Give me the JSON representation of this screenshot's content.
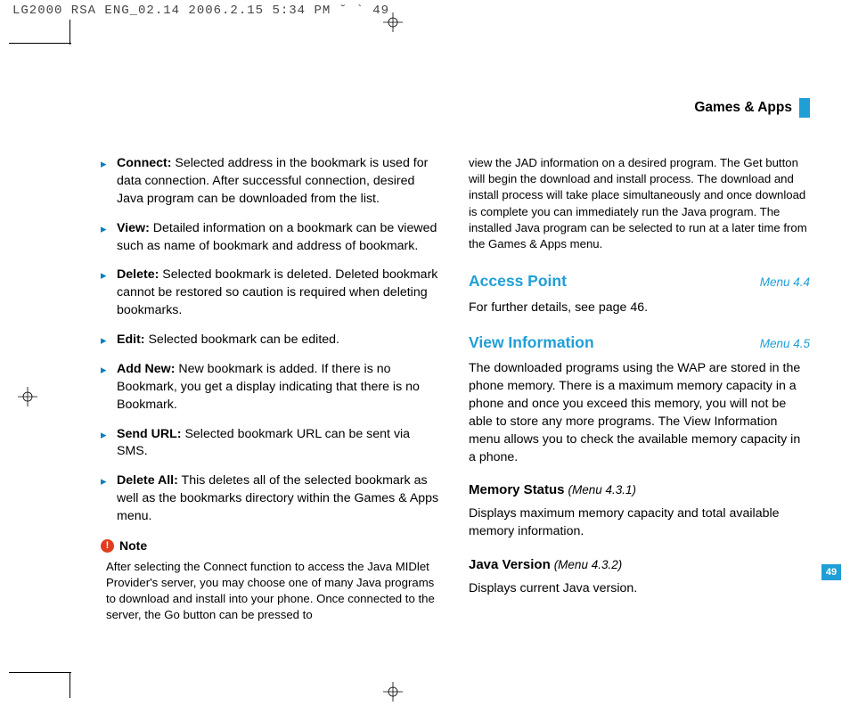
{
  "fileHeader": "LG2000 RSA ENG_02.14  2006.2.15 5:34 PM  ˘   ` 49",
  "header": {
    "title": "Games & Apps"
  },
  "leftCol": {
    "bullets": [
      {
        "term": "Connect:",
        "text": " Selected address in the bookmark is used for data connection. After successful connection, desired Java program can be downloaded from the list."
      },
      {
        "term": "View:",
        "text": " Detailed information on a bookmark can be viewed such as name of bookmark and address of bookmark."
      },
      {
        "term": "Delete:",
        "text": " Selected bookmark is deleted. Deleted bookmark cannot be restored so caution is required when deleting bookmarks."
      },
      {
        "term": "Edit:",
        "text": " Selected bookmark can be edited."
      },
      {
        "term": "Add New:",
        "text": " New bookmark is added. If there is no Bookmark, you get a display indicating that there is no Bookmark."
      },
      {
        "term": "Send URL:",
        "text": " Selected bookmark URL can be sent via SMS."
      },
      {
        "term": "Delete All:",
        "text": " This deletes all of the selected bookmark as well as the bookmarks directory within the Games & Apps menu."
      }
    ],
    "noteLabel": "Note",
    "noteText": "After selecting the Connect function to access the Java MIDlet Provider's server, you may choose one of many Java programs to download and install into your phone. Once connected to the server, the Go button can be pressed to"
  },
  "rightCol": {
    "continueText": "view the JAD information on a desired program. The Get button will begin the download and install process. The download and install process will take place simultaneously and once download is complete you can immediately run the Java program. The installed Java program can be selected to run at a later time from the Games & Apps menu.",
    "section1": {
      "title": "Access Point",
      "menu": "Menu 4.4",
      "text": "For further details, see page 46."
    },
    "section2": {
      "title": "View Information",
      "menu": "Menu 4.5",
      "text": "The downloaded programs using the WAP are stored in the phone memory. There is a maximum memory capacity in a phone and once you exceed this memory, you will not be able to store any more programs. The View Information menu allows you to check the available memory capacity in a phone."
    },
    "sub1": {
      "title": "Memory Status",
      "menu": "(Menu 4.3.1)",
      "text": "Displays maximum memory capacity and total available memory information."
    },
    "sub2": {
      "title": "Java Version",
      "menu": "(Menu 4.3.2)",
      "text": "Displays current Java version."
    }
  },
  "pageNum": "49"
}
